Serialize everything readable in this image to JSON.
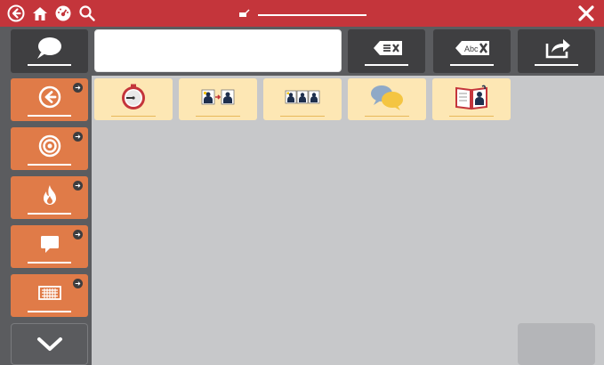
{
  "topbar": {
    "icons": [
      "back-circle-icon",
      "home-icon",
      "dashboard-icon",
      "search-icon",
      "close-icon"
    ],
    "center_icon": "pencil-keyboard-icon"
  },
  "message_bar": {
    "speak_icon": "speech-bubble-icon",
    "input_value": "",
    "clear_word_icon": "backspace-lines-icon",
    "clear_text_icon": "backspace-abc-icon",
    "clear_text_label": "Abc",
    "share_icon": "share-icon"
  },
  "sidebar": {
    "items": [
      {
        "icon": "back-arrow-icon"
      },
      {
        "icon": "target-icon"
      },
      {
        "icon": "fire-icon"
      },
      {
        "icon": "chat-icon"
      },
      {
        "icon": "keyboard-icon"
      }
    ],
    "scroll_down_icon": "chevron-down-icon"
  },
  "tiles": [
    {
      "icon": "stopwatch-icon"
    },
    {
      "icon": "people-arrow-icon"
    },
    {
      "icon": "people-group-icon"
    },
    {
      "icon": "conversation-bubbles-icon"
    },
    {
      "icon": "open-book-icon"
    }
  ],
  "colors": {
    "topbar": "#c4353b",
    "dark_panel": "#5b5c5f",
    "dark_button": "#3f3f41",
    "orange": "#e07b48",
    "tile": "#fde7b4",
    "background": "#c7c8ca"
  }
}
